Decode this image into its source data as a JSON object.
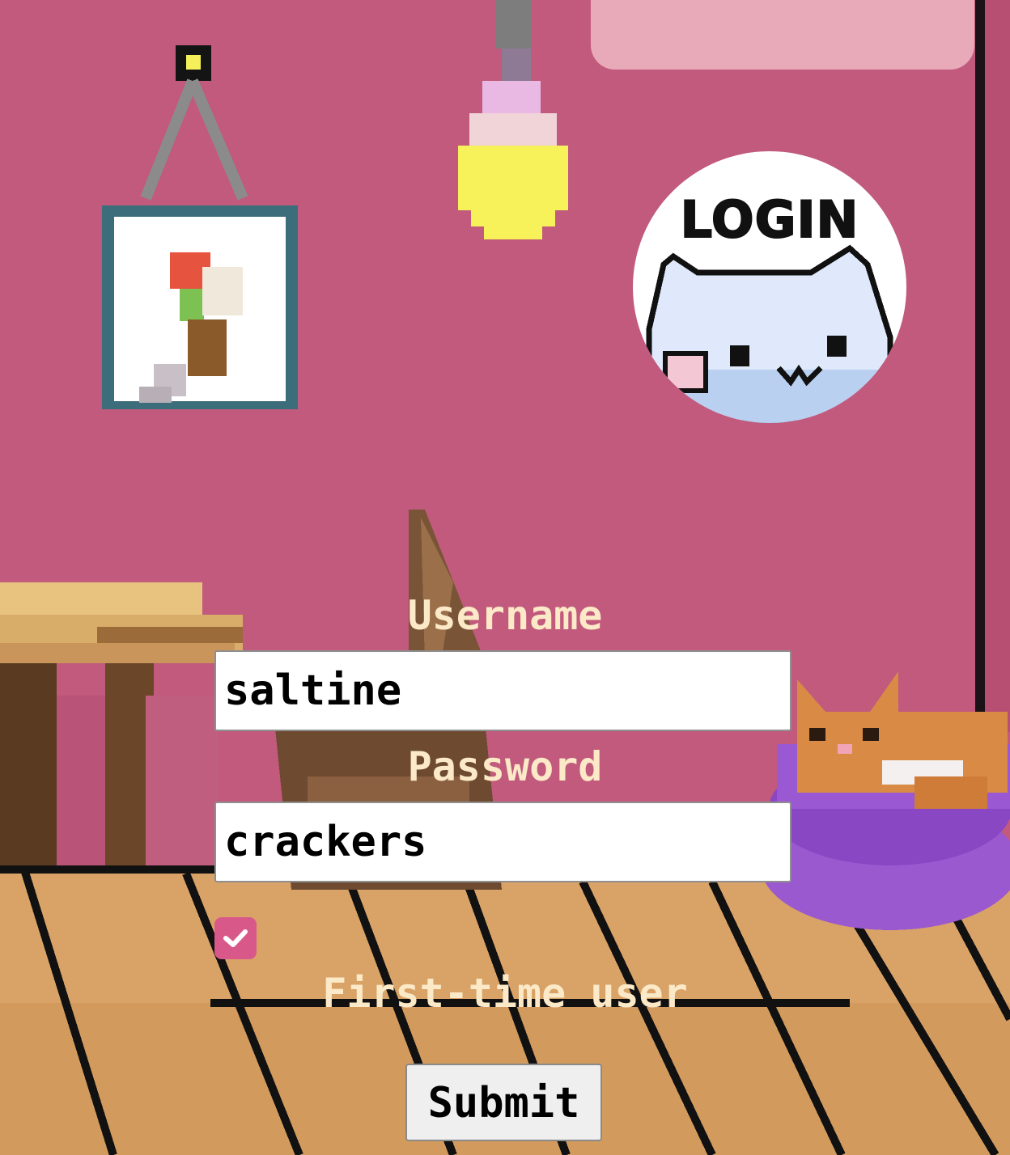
{
  "badge": {
    "text": "LOGIN"
  },
  "form": {
    "username_label": "Username",
    "username_value": "saltine",
    "password_label": "Password",
    "password_value": "crackers",
    "first_time_checked": true,
    "first_time_label": "First-time user",
    "submit_label": "Submit"
  },
  "colors": {
    "wall": "#c15a7d",
    "label_text": "#fbe9c8",
    "checkbox_accent": "#d9588a",
    "floor": "#d9a266",
    "cat_bed": "#9b59d0"
  }
}
